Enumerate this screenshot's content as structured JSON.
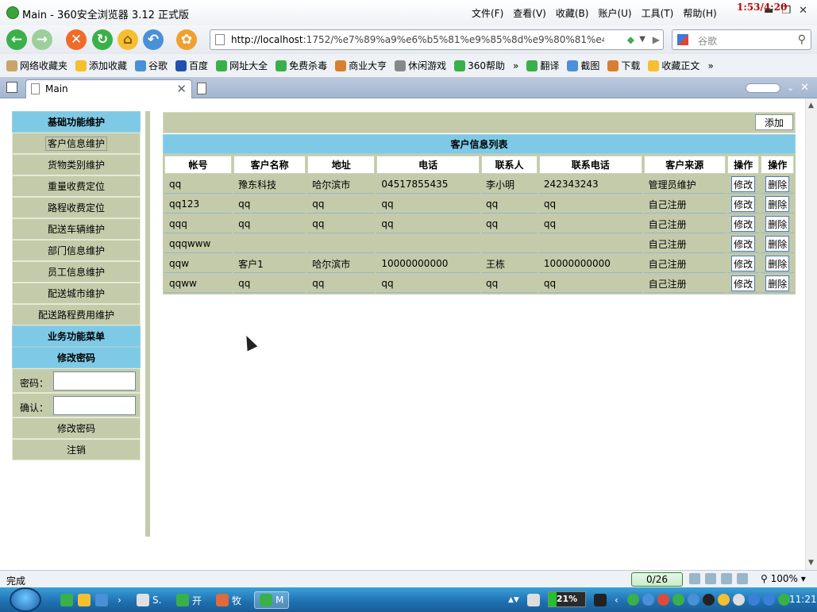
{
  "browser": {
    "window_title": "Main - 360安全浏览器 3.12 正式版",
    "menu": [
      "文件(F)",
      "查看(V)",
      "收藏(B)",
      "账户(U)",
      "工具(T)",
      "帮助(H)"
    ],
    "clock_overlay": "1:53/4:20",
    "address_host": "http://localhost",
    "address_rest": ":1752/%e7%89%a9%e6%b5%81%e9%85%8d%e9%80%81%e4%b",
    "search_placeholder": "谷歌",
    "favorites": [
      "网络收藏夹",
      "添加收藏",
      "谷歌",
      "百度",
      "网址大全",
      "免费杀毒",
      "商业大亨",
      "休闲游戏",
      "360帮助",
      "»",
      "翻译",
      "截图",
      "下载",
      "收藏正文",
      "»"
    ],
    "tab_label": "Main",
    "status_text": "完成",
    "download_counter": "0/26",
    "zoom": "100%"
  },
  "sidebar": {
    "basic_header": "基础功能维护",
    "items": [
      "客户信息维护",
      "货物类别维护",
      "重量收费定位",
      "路程收费定位",
      "配送车辆维护",
      "部门信息维护",
      "员工信息维护",
      "配送城市维护",
      "配送路程费用维护"
    ],
    "business_header": "业务功能菜单",
    "password_header": "修改密码",
    "password_label": "密码：",
    "confirm_label": "确认：",
    "change_password_button": "修改密码",
    "logout_button": "注销"
  },
  "main": {
    "add_button": "添加",
    "list_title": "客户信息列表",
    "columns": [
      "帐号",
      "客户名称",
      "地址",
      "电话",
      "联系人",
      "联系电话",
      "客户来源",
      "操作",
      "操作"
    ],
    "edit_label": "修改",
    "delete_label": "删除",
    "rows": [
      [
        "qq",
        "豫东科技",
        "哈尔滨市",
        "04517855435",
        "李小明",
        "242343243",
        "管理员维护"
      ],
      [
        "qq123",
        "qq",
        "qq",
        "qq",
        "qq",
        "qq",
        "自己注册"
      ],
      [
        "qqq",
        "qq",
        "qq",
        "qq",
        "qq",
        "qq",
        "自己注册"
      ],
      [
        "qqqwww",
        "",
        "",
        "",
        "",
        "",
        "自己注册"
      ],
      [
        "qqw",
        "客户1",
        "哈尔滨市",
        "10000000000",
        "王栋",
        "10000000000",
        "自己注册"
      ],
      [
        "qqww",
        "qq",
        "qq",
        "qq",
        "qq",
        "qq",
        "自己注册"
      ]
    ]
  },
  "taskbar": {
    "items": [
      "S.",
      "开",
      "牧",
      "M"
    ],
    "cpu_label": "21%",
    "cpu_fraction": 0.21,
    "time": "11:21"
  }
}
